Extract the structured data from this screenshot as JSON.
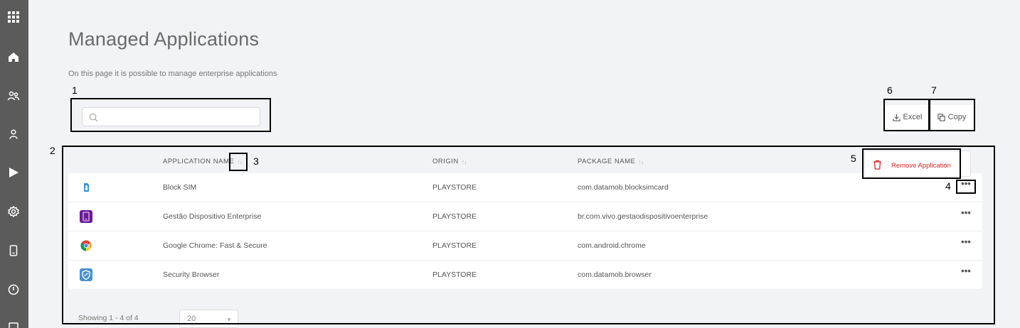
{
  "sidebar": {
    "items": [
      {
        "icon": "apps-grid-icon"
      },
      {
        "icon": "home-icon"
      },
      {
        "icon": "users-group-icon"
      },
      {
        "icon": "user-icon"
      },
      {
        "icon": "play-store-icon"
      },
      {
        "icon": "settings-icon"
      },
      {
        "icon": "device-icon"
      },
      {
        "icon": "power-icon"
      },
      {
        "icon": "list-icon"
      }
    ]
  },
  "header": {
    "title": "Managed Applications",
    "subtitle": "On this page it is possible to manage enterprise applications"
  },
  "search": {
    "placeholder": "",
    "value": ""
  },
  "toolbar": {
    "excel_label": "Excel",
    "copy_label": "Copy"
  },
  "annotations": [
    "1",
    "2",
    "3",
    "4",
    "5",
    "6",
    "7"
  ],
  "table": {
    "columns": {
      "application_name": "APPLICATION NAME",
      "origin": "ORIGIN",
      "package_name": "PACKAGE NAME"
    },
    "sort_glyph": "↑↓",
    "more_glyph": "•••",
    "rows": [
      {
        "name": "Block SIM",
        "origin": "PLAYSTORE",
        "package": "com.datamob.blocksimcard",
        "icon": "block-sim-icon"
      },
      {
        "name": "Gestão Dispositivo Enterprise",
        "origin": "PLAYSTORE",
        "package": "br.com.vivo.gestaodispositivoenterprise",
        "icon": "gestao-dispositivo-icon"
      },
      {
        "name": "Google Chrome: Fast & Secure",
        "origin": "PLAYSTORE",
        "package": "com.android.chrome",
        "icon": "chrome-icon"
      },
      {
        "name": "Security Browser",
        "origin": "PLAYSTORE",
        "package": "com.datamob.browser",
        "icon": "security-browser-icon"
      }
    ]
  },
  "row_menu": {
    "remove_label": "Remove Application"
  },
  "footer": {
    "showing": "Showing 1 - 4 of 4",
    "page_size": "20"
  },
  "colors": {
    "sidebar": "#5b5b5b",
    "danger": "#d9262c",
    "background": "#f2f3f7"
  }
}
